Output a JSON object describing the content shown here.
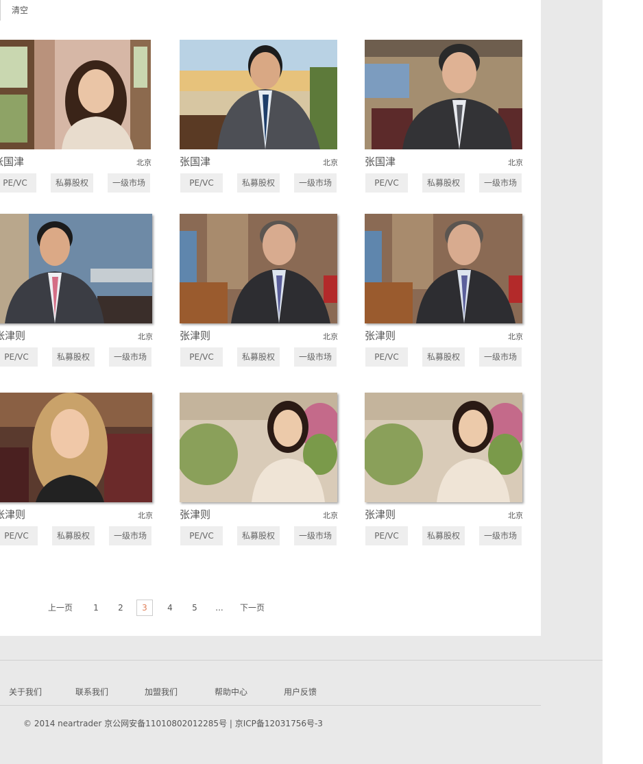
{
  "toolbar": {
    "clear_label": "清空"
  },
  "tags": [
    "PE/VC",
    "私募股权",
    "一级市场"
  ],
  "cards": [
    {
      "name": "张国津",
      "city": "北京",
      "photo_desc": "woman-beige-blazer"
    },
    {
      "name": "张国津",
      "city": "北京",
      "photo_desc": "man-gray-suit-lobby"
    },
    {
      "name": "张国津",
      "city": "北京",
      "photo_desc": "man-glasses-pinstripe"
    },
    {
      "name": "张津则",
      "city": "北京",
      "photo_desc": "man-pink-tie"
    },
    {
      "name": "张津则",
      "city": "北京",
      "photo_desc": "man-gray-hair-office"
    },
    {
      "name": "张津则",
      "city": "北京",
      "photo_desc": "man-gray-hair-office"
    },
    {
      "name": "张津则",
      "city": "北京",
      "photo_desc": "woman-blonde"
    },
    {
      "name": "张津则",
      "city": "北京",
      "photo_desc": "woman-garden"
    },
    {
      "name": "张津则",
      "city": "北京",
      "photo_desc": "woman-garden"
    }
  ],
  "pagination": {
    "prev": "上一页",
    "pages": [
      "1",
      "2",
      "3",
      "4",
      "5",
      "..."
    ],
    "current": "3",
    "next": "下一页"
  },
  "footer": {
    "links": [
      "关于我们",
      "联系我们",
      "加盟我们",
      "帮助中心",
      "用户反馈"
    ],
    "copyright": "© 2014 neartrader 京公网安备11010802012285号 | 京ICP备12031756号-3"
  },
  "colors": {
    "page_bg": "#e9e9e9",
    "tag_bg": "#eeeeee",
    "current_page": "#e0805a"
  }
}
